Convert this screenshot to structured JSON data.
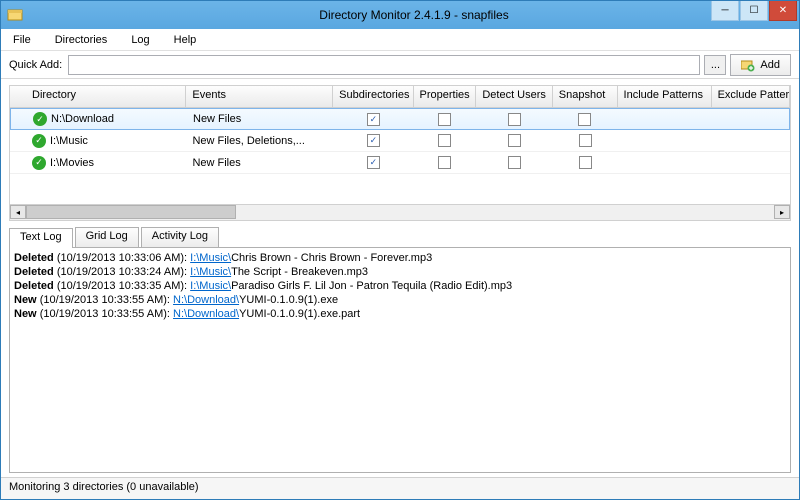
{
  "title": "Directory Monitor 2.4.1.9 - snapfiles",
  "menu": {
    "file": "File",
    "dirs": "Directories",
    "log": "Log",
    "help": "Help"
  },
  "quickadd": {
    "label": "Quick Add:",
    "browse": "...",
    "add": "Add",
    "placeholder": ""
  },
  "columns": {
    "dir": "Directory",
    "ev": "Events",
    "sub": "Subdirectories",
    "prop": "Properties",
    "det": "Detect Users",
    "snap": "Snapshot",
    "inc": "Include Patterns",
    "exc": "Exclude Pattern"
  },
  "rows": [
    {
      "dir": "N:\\Download",
      "ev": "New Files",
      "sub": true,
      "prop": false,
      "det": false,
      "snap": false,
      "sel": true
    },
    {
      "dir": "I:\\Music",
      "ev": "New Files, Deletions,...",
      "sub": true,
      "prop": false,
      "det": false,
      "snap": false,
      "sel": false
    },
    {
      "dir": "I:\\Movies",
      "ev": "New Files",
      "sub": true,
      "prop": false,
      "det": false,
      "snap": false,
      "sel": false
    }
  ],
  "tabs": {
    "text": "Text Log",
    "grid": "Grid Log",
    "act": "Activity Log"
  },
  "log": [
    {
      "action": "Deleted",
      "ts": "(10/19/2013 10:33:06 AM):",
      "link": "I:\\Music\\",
      "file": "Chris Brown - Chris Brown - Forever.mp3"
    },
    {
      "action": "Deleted",
      "ts": "(10/19/2013 10:33:24 AM):",
      "link": "I:\\Music\\",
      "file": "The Script - Breakeven.mp3"
    },
    {
      "action": "Deleted",
      "ts": "(10/19/2013 10:33:35 AM):",
      "link": "I:\\Music\\",
      "file": "Paradiso Girls F. Lil Jon - Patron Tequila (Radio Edit).mp3"
    },
    {
      "action": "New",
      "ts": "(10/19/2013 10:33:55 AM):",
      "link": "N:\\Download\\",
      "file": "YUMI-0.1.0.9(1).exe"
    },
    {
      "action": "New",
      "ts": "(10/19/2013 10:33:55 AM):",
      "link": "N:\\Download\\",
      "file": "YUMI-0.1.0.9(1).exe.part"
    }
  ],
  "status": "Monitoring 3 directories (0 unavailable)"
}
